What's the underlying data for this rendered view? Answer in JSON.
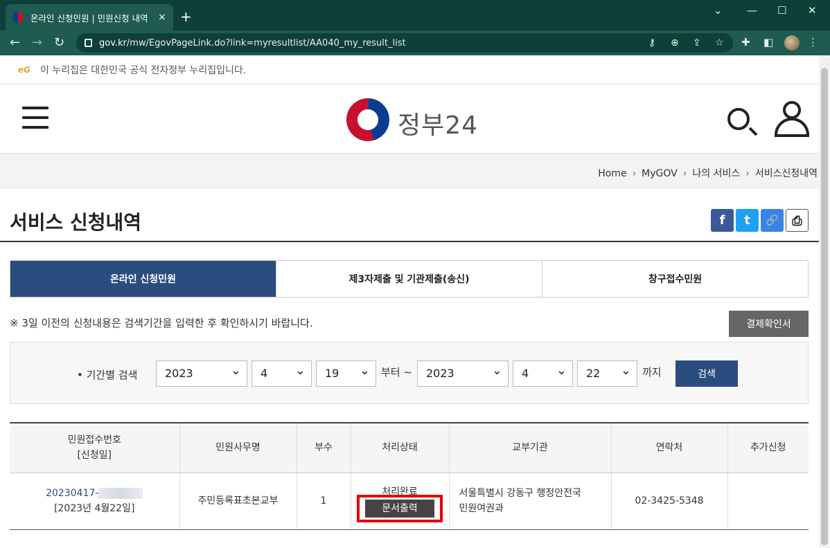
{
  "browser": {
    "tab_title": "온라인 신청민원 | 민원신청 내역",
    "tab_close": "×",
    "new_tab": "+",
    "url_domain": "gov.kr",
    "url_path": "/mw/EgovPageLink.do?link=myresultlist/AA040_my_result_list"
  },
  "site": {
    "gov_notice": "이 누리집은 대한민국 공식 전자정부 누리집입니다.",
    "eg_logo": "eG",
    "logo_text": "정부24"
  },
  "breadcrumb": [
    "Home",
    "MyGOV",
    "나의 서비스",
    "서비스신청내역"
  ],
  "page_title": "서비스 신청내역",
  "share": {
    "facebook": "f",
    "twitter": "t",
    "link": "🔗",
    "print": "⎙"
  },
  "tabs": [
    "온라인 신청민원",
    "제3자제출 및 기관제출(송신)",
    "창구접수민원"
  ],
  "notice": "※ 3일 이전의 신청내용은 검색기간을 입력한 후 확인하시기 바랍니다.",
  "pay_button": "결제확인서",
  "search": {
    "label": "• 기간별 검색",
    "from_year": "2023",
    "from_month": "4",
    "from_day": "19",
    "from_suffix": "부터 ~",
    "to_year": "2023",
    "to_month": "4",
    "to_day": "22",
    "to_suffix": "까지",
    "button": "검색"
  },
  "table": {
    "headers": [
      "민원접수번호",
      "[신청일]",
      "민원사무명",
      "부수",
      "처리상태",
      "교부기관",
      "연락처",
      "추가신청"
    ],
    "row": {
      "receipt_no": "20230417-",
      "apply_date": "[2023년 4월22일]",
      "service_name": "주민등록표초본교부",
      "copies": "1",
      "status": "처리완료",
      "print_button": "문서출력",
      "org_line1": "서울특별시 강동구 행정안전국",
      "org_line2": "민원여권과",
      "contact": "02-3425-5348",
      "extra": ""
    }
  },
  "colors": {
    "accent": "#2b4c7e",
    "highlight": "#e60000",
    "chrome": "#0f3f3a"
  }
}
